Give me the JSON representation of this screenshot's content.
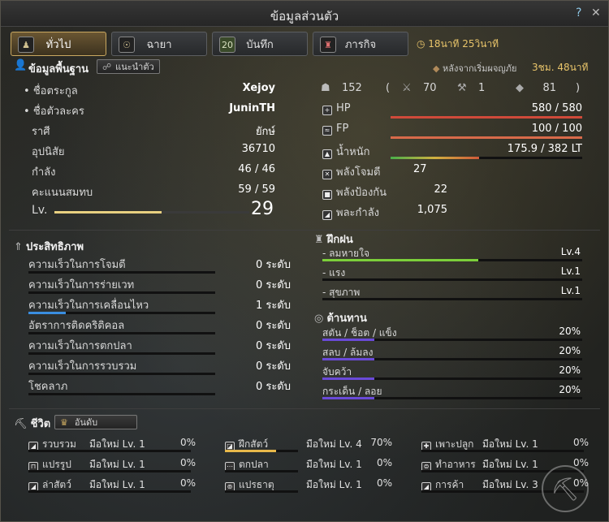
{
  "window": {
    "title": "ข้อมูลส่วนตัว",
    "help": "?",
    "close": "✕"
  },
  "tabs": [
    {
      "label": "ทั่วไป",
      "icon": "person-icon",
      "active": true
    },
    {
      "label": "ฉายา",
      "icon": "medal-icon",
      "active": false
    },
    {
      "label": "บันทึก",
      "icon": "calendar-icon",
      "active": false
    },
    {
      "label": "ภารกิจ",
      "icon": "quest-icon",
      "active": false
    }
  ],
  "calendar_day": "20",
  "timer": "18นาที 25วินาที",
  "basic": {
    "header": "ข้อมูลพื้นฐาน",
    "intro_button": "แนะนำตัว",
    "adventure_label": "หลังจากเริ่มผจญภัย",
    "adventure_time": "3ชม. 48นาที",
    "rows": [
      {
        "label": "ชื่อตระกูล",
        "value": "Xejoy",
        "bullet": true
      },
      {
        "label": "ชื่อตัวละคร",
        "value": "JuninTH",
        "bullet": true
      },
      {
        "label": "ราศี",
        "value": "ยักษ์"
      },
      {
        "label": "อุปนิสัย",
        "value": "36710"
      },
      {
        "label": "กำลัง",
        "value": "46 / 46"
      },
      {
        "label": "คะแนนสมทบ",
        "value": "59 / 59"
      }
    ],
    "level_label": "Lv.",
    "level": "29",
    "level_progress": 0.55
  },
  "stats": {
    "contribution": "152",
    "paren_open": "(",
    "paren_close": ")",
    "combat": "70",
    "life": "1",
    "energy": "81",
    "hp_label": "HP",
    "hp": "580 / 580",
    "fp_label": "FP",
    "fp": "100 / 100",
    "weight_label": "น้ำหนัก",
    "weight": "175.9 / 382 LT",
    "attack_label": "พลังโจมตี",
    "attack": "27",
    "defense_label": "พลังป้องกัน",
    "defense": "22",
    "power_label": "พละกำลัง",
    "power": "1,075",
    "weight_fill": 0.46
  },
  "efficiency": {
    "header": "ประสิทธิภาพ",
    "items": [
      {
        "label": "ความเร็วในการโจมตี",
        "value": "0 ระดับ",
        "fill": 0
      },
      {
        "label": "ความเร็วในการร่ายเวท",
        "value": "0 ระดับ",
        "fill": 0
      },
      {
        "label": "ความเร็วในการเคลื่อนไหว",
        "value": "1 ระดับ",
        "fill": 0.2
      },
      {
        "label": "อัตราการติดคริติคอล",
        "value": "0 ระดับ",
        "fill": 0
      },
      {
        "label": "ความเร็วในการตกปลา",
        "value": "0 ระดับ",
        "fill": 0
      },
      {
        "label": "ความเร็วในการรวบรวม",
        "value": "0 ระดับ",
        "fill": 0
      },
      {
        "label": "โชคลาภ",
        "value": "0 ระดับ",
        "fill": 0
      }
    ]
  },
  "training": {
    "header": "ฝึกฝน",
    "items": [
      {
        "label": "- ลมหายใจ",
        "value": "Lv.4",
        "fill": 0.6
      },
      {
        "label": "- แรง",
        "value": "Lv.1",
        "fill": 0
      },
      {
        "label": "- สุขภาพ",
        "value": "Lv.1",
        "fill": 0
      }
    ]
  },
  "resistance": {
    "header": "ต้านทาน",
    "items": [
      {
        "label": "สตัน / ช็อต / แข็ง",
        "value": "20%",
        "fill": 0.2
      },
      {
        "label": "สลบ / ล้มลง",
        "value": "20%",
        "fill": 0.2
      },
      {
        "label": "จับคว้า",
        "value": "20%",
        "fill": 0.2
      },
      {
        "label": "กระเด็น / ลอย",
        "value": "20%",
        "fill": 0.2
      }
    ]
  },
  "life": {
    "header": "ชีวิต",
    "rank_button": "อันดับ",
    "skills": [
      {
        "name": "รวบรวม",
        "rank": "มือใหม่ Lv. 1",
        "pct": "0%",
        "fill": 0
      },
      {
        "name": "ฝึกสัตว์",
        "rank": "มือใหม่ Lv. 4",
        "pct": "70%",
        "fill": 0.7
      },
      {
        "name": "เพาะปลูก",
        "rank": "มือใหม่ Lv. 1",
        "pct": "0%",
        "fill": 0
      },
      {
        "name": "แปรรูป",
        "rank": "มือใหม่ Lv. 1",
        "pct": "0%",
        "fill": 0
      },
      {
        "name": "ตกปลา",
        "rank": "มือใหม่ Lv. 1",
        "pct": "0%",
        "fill": 0
      },
      {
        "name": "ทำอาหาร",
        "rank": "มือใหม่ Lv. 1",
        "pct": "0%",
        "fill": 0
      },
      {
        "name": "ล่าสัตว์",
        "rank": "มือใหม่ Lv. 1",
        "pct": "0%",
        "fill": 0
      },
      {
        "name": "แปรธาตุ",
        "rank": "มือใหม่ Lv. 1",
        "pct": "0%",
        "fill": 0
      },
      {
        "name": "การค้า",
        "rank": "มือใหม่ Lv. 3",
        "pct": "0%",
        "fill": 0
      }
    ]
  },
  "colors": {
    "accent_gold": "#e8c46a",
    "hp_bar": "#d04a3a",
    "fp_bar": "#d86a4a",
    "green_bar": "#7ccf3a",
    "blue_bar": "#3a8ee0",
    "purple_bar": "#6a4ad8",
    "life_bar": "#e8b84a"
  }
}
